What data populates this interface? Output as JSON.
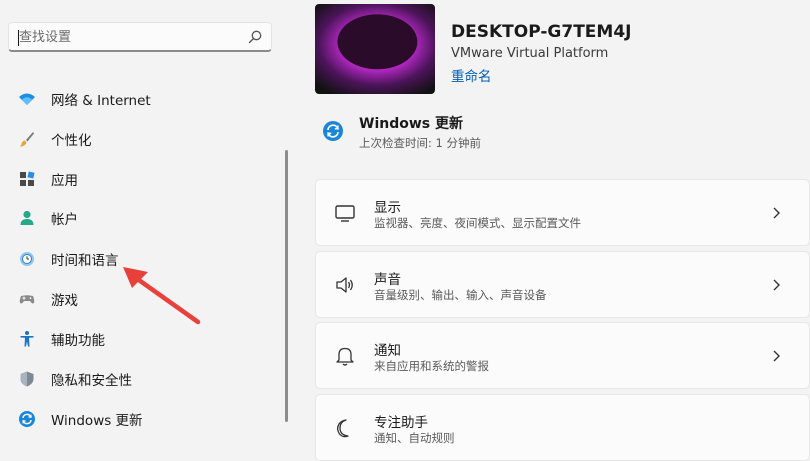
{
  "search": {
    "placeholder": "查找设置"
  },
  "sidebar": {
    "items": [
      {
        "label": "网络 & Internet",
        "icon": "wifi-icon"
      },
      {
        "label": "个性化",
        "icon": "brush-icon"
      },
      {
        "label": "应用",
        "icon": "apps-icon"
      },
      {
        "label": "帐户",
        "icon": "person-icon"
      },
      {
        "label": "时间和语言",
        "icon": "globe-clock-icon"
      },
      {
        "label": "游戏",
        "icon": "gamepad-icon"
      },
      {
        "label": "辅助功能",
        "icon": "accessibility-icon"
      },
      {
        "label": "隐私和安全性",
        "icon": "shield-icon"
      },
      {
        "label": "Windows 更新",
        "icon": "update-icon"
      }
    ]
  },
  "device": {
    "name": "DESKTOP-G7TEM4J",
    "model": "VMware Virtual Platform",
    "rename_label": "重命名"
  },
  "windows_update": {
    "title": "Windows 更新",
    "subtitle": "上次检查时间: 1 分钟前"
  },
  "cards": [
    {
      "title": "显示",
      "subtitle": "监视器、亮度、夜间模式、显示配置文件",
      "icon": "monitor-icon"
    },
    {
      "title": "声音",
      "subtitle": "音量级别、输出、输入、声音设备",
      "icon": "speaker-icon"
    },
    {
      "title": "通知",
      "subtitle": "来自应用和系统的警报",
      "icon": "bell-icon"
    },
    {
      "title": "专注助手",
      "subtitle": "通知、自动规则",
      "icon": "moon-icon"
    }
  ],
  "colors": {
    "accent": "#005fb8",
    "background": "#f3f3f3",
    "card": "#fbfbfb",
    "arrow": "#e8413b"
  }
}
